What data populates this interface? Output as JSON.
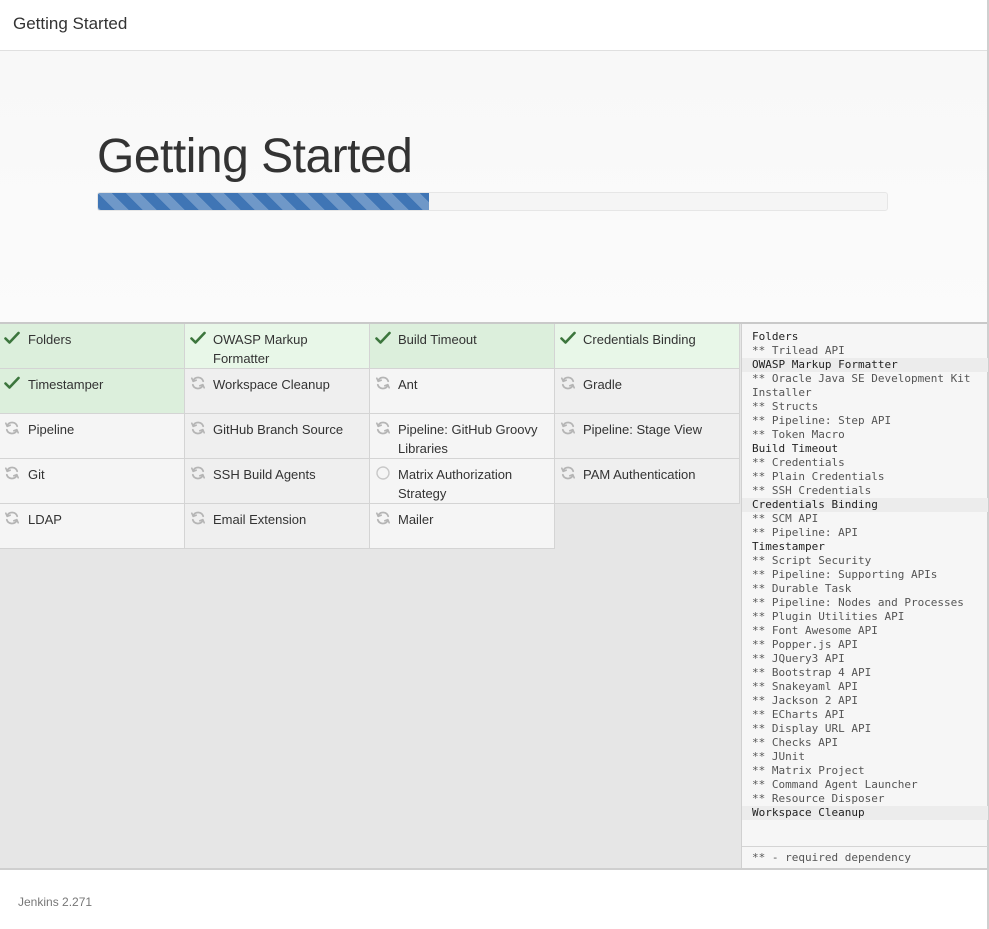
{
  "header": {
    "title": "Getting Started"
  },
  "hero": {
    "heading": "Getting Started",
    "progress": 0.42
  },
  "plugins": [
    {
      "label": "Folders",
      "status": "success",
      "icon": "check-icon"
    },
    {
      "label": "OWASP Markup Formatter",
      "status": "success",
      "icon": "check-icon"
    },
    {
      "label": "Build Timeout",
      "status": "success",
      "icon": "check-icon"
    },
    {
      "label": "Credentials Binding",
      "status": "success",
      "icon": "check-icon"
    },
    {
      "label": "Timestamper",
      "status": "success",
      "icon": "check-icon"
    },
    {
      "label": "Workspace Cleanup",
      "status": "installing",
      "icon": "refresh-icon"
    },
    {
      "label": "Ant",
      "status": "installing",
      "icon": "refresh-icon"
    },
    {
      "label": "Gradle",
      "status": "installing",
      "icon": "refresh-icon"
    },
    {
      "label": "Pipeline",
      "status": "installing",
      "icon": "refresh-icon"
    },
    {
      "label": "GitHub Branch Source",
      "status": "installing",
      "icon": "refresh-icon"
    },
    {
      "label": "Pipeline: GitHub Groovy Libraries",
      "status": "installing",
      "icon": "refresh-icon"
    },
    {
      "label": "Pipeline: Stage View",
      "status": "installing",
      "icon": "refresh-icon"
    },
    {
      "label": "Git",
      "status": "installing",
      "icon": "refresh-icon"
    },
    {
      "label": "SSH Build Agents",
      "status": "installing",
      "icon": "refresh-icon"
    },
    {
      "label": "Matrix Authorization Strategy",
      "status": "pending",
      "icon": "circle-icon"
    },
    {
      "label": "PAM Authentication",
      "status": "installing",
      "icon": "refresh-icon"
    },
    {
      "label": "LDAP",
      "status": "installing",
      "icon": "refresh-icon"
    },
    {
      "label": "Email Extension",
      "status": "installing",
      "icon": "refresh-icon"
    },
    {
      "label": "Mailer",
      "status": "installing",
      "icon": "refresh-icon"
    }
  ],
  "log": {
    "lines": [
      {
        "text": "Folders",
        "kind": "plugin"
      },
      {
        "text": "** Trilead API",
        "kind": "dep"
      },
      {
        "text": "OWASP Markup Formatter",
        "kind": "plugin"
      },
      {
        "text": "** Oracle Java SE Development Kit Installer",
        "kind": "dep"
      },
      {
        "text": "** Structs",
        "kind": "dep"
      },
      {
        "text": "** Pipeline: Step API",
        "kind": "dep"
      },
      {
        "text": "** Token Macro",
        "kind": "dep"
      },
      {
        "text": "Build Timeout",
        "kind": "plugin"
      },
      {
        "text": "** Credentials",
        "kind": "dep"
      },
      {
        "text": "** Plain Credentials",
        "kind": "dep"
      },
      {
        "text": "** SSH Credentials",
        "kind": "dep"
      },
      {
        "text": "Credentials Binding",
        "kind": "plugin"
      },
      {
        "text": "** SCM API",
        "kind": "dep"
      },
      {
        "text": "** Pipeline: API",
        "kind": "dep"
      },
      {
        "text": "Timestamper",
        "kind": "plugin"
      },
      {
        "text": "** Script Security",
        "kind": "dep"
      },
      {
        "text": "** Pipeline: Supporting APIs",
        "kind": "dep"
      },
      {
        "text": "** Durable Task",
        "kind": "dep"
      },
      {
        "text": "** Pipeline: Nodes and Processes",
        "kind": "dep"
      },
      {
        "text": "** Plugin Utilities API",
        "kind": "dep"
      },
      {
        "text": "** Font Awesome API",
        "kind": "dep"
      },
      {
        "text": "** Popper.js API",
        "kind": "dep"
      },
      {
        "text": "** JQuery3 API",
        "kind": "dep"
      },
      {
        "text": "** Bootstrap 4 API",
        "kind": "dep"
      },
      {
        "text": "** Snakeyaml API",
        "kind": "dep"
      },
      {
        "text": "** Jackson 2 API",
        "kind": "dep"
      },
      {
        "text": "** ECharts API",
        "kind": "dep"
      },
      {
        "text": "** Display URL API",
        "kind": "dep"
      },
      {
        "text": "** Checks API",
        "kind": "dep"
      },
      {
        "text": "** JUnit",
        "kind": "dep"
      },
      {
        "text": "** Matrix Project",
        "kind": "dep"
      },
      {
        "text": "** Command Agent Launcher",
        "kind": "dep"
      },
      {
        "text": "** Resource Disposer",
        "kind": "dep"
      },
      {
        "text": "Workspace Cleanup",
        "kind": "plugin"
      }
    ],
    "legend": "** - required dependency"
  },
  "footer": {
    "version": "Jenkins 2.271"
  },
  "colors": {
    "progress": "#3f75b5",
    "success_bg": "#dcefdc",
    "check": "#3c763d",
    "spinner": "#b5b5b5"
  }
}
